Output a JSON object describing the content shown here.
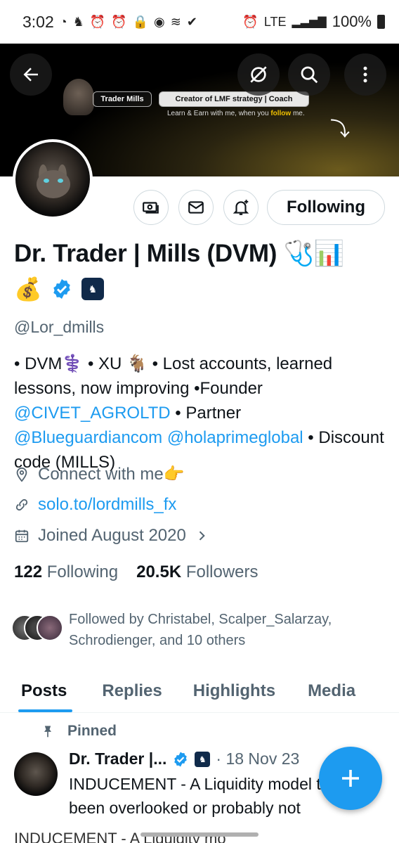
{
  "status_bar": {
    "time": "3:02",
    "network": "LTE",
    "battery": "100%"
  },
  "banner": {
    "tag_name": "Trader Mills",
    "tag_role": "Creator of LMF strategy | Coach",
    "subtitle_pre": "Learn & Earn with me, when you ",
    "subtitle_highlight": "follow",
    "subtitle_post": " me."
  },
  "header_icons": {
    "back": "arrow-left-icon",
    "grok": "grok-icon",
    "search": "search-icon",
    "more": "more-vertical-icon"
  },
  "profile": {
    "name": "Dr. Trader | Mills (DVM) 🩺📊",
    "name_emoji2": "💰",
    "handle": "@Lor_dmills",
    "follow_button": "Following"
  },
  "bio": {
    "part1": "• DVM⚕️ • XU 🐐 • Lost accounts, learned lessons, now improving •Founder ",
    "mention1": "@CIVET_AGROLTD",
    "part2": " • Partner ",
    "mention2": "@Blueguardiancom",
    "part3": " ",
    "mention3": "@holaprimeglobal",
    "part4": " • Discount code (MILLS)"
  },
  "meta": {
    "location": "Connect with me👉",
    "link": "solo.to/lordmills_fx",
    "joined": "Joined August 2020"
  },
  "counts": {
    "following_num": "122",
    "following_label": "Following",
    "followers_num": "20.5K",
    "followers_label": "Followers"
  },
  "followed_by": "Followed by Christabel, Scalper_Salarzay, Schrodienger, and 10 others",
  "tabs": [
    "Posts",
    "Replies",
    "Highlights",
    "Media"
  ],
  "post": {
    "pinned_label": "Pinned",
    "author": "Dr. Trader |...",
    "date": "· 18 Nov 23",
    "text": "INDUCEMENT - A Liquidity model that has been overlooked or probably not",
    "next_text": "INDUCEMENT - A Liquidity mo"
  },
  "colors": {
    "accent": "#1d9bf0",
    "text": "#0f1419",
    "secondary": "#536471"
  }
}
